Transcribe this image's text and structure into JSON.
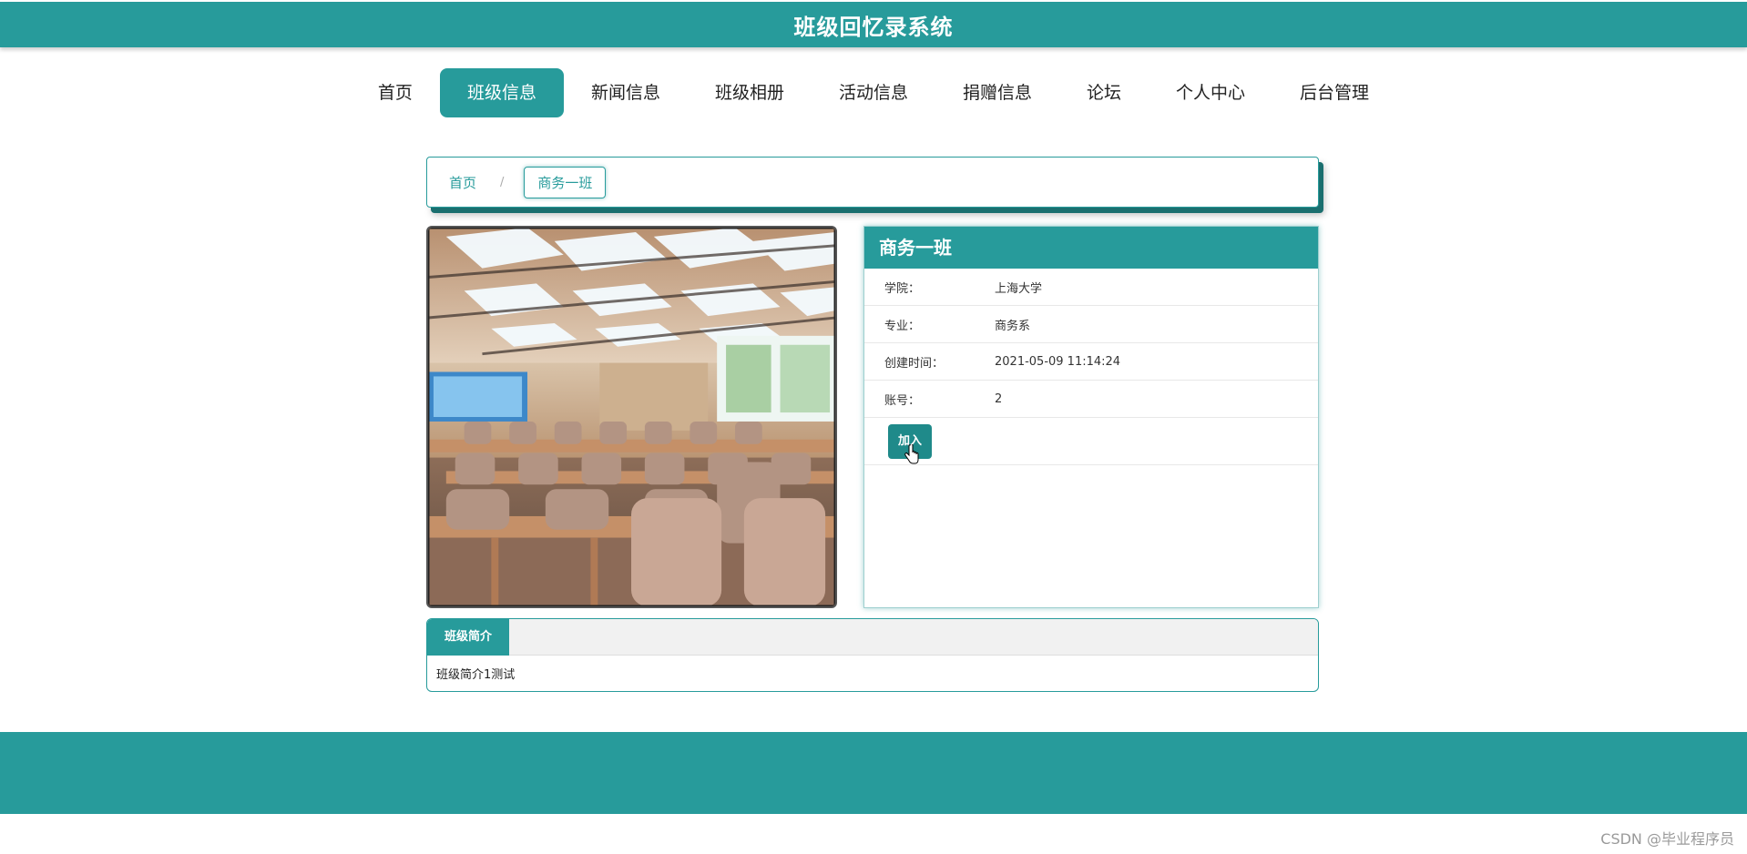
{
  "header": {
    "title": "班级回忆录系统"
  },
  "nav": {
    "items": [
      {
        "label": "首页",
        "active": false
      },
      {
        "label": "班级信息",
        "active": true
      },
      {
        "label": "新闻信息",
        "active": false
      },
      {
        "label": "班级相册",
        "active": false
      },
      {
        "label": "活动信息",
        "active": false
      },
      {
        "label": "捐赠信息",
        "active": false
      },
      {
        "label": "论坛",
        "active": false
      },
      {
        "label": "个人中心",
        "active": false
      },
      {
        "label": "后台管理",
        "active": false
      }
    ]
  },
  "breadcrumb": {
    "home": "首页",
    "separator": "/",
    "current": "商务一班"
  },
  "detail": {
    "title": "商务一班",
    "fields": [
      {
        "label": "学院：",
        "value": "上海大学"
      },
      {
        "label": "专业：",
        "value": "商务系"
      },
      {
        "label": "创建时间：",
        "value": "2021-05-09 11:14:24"
      },
      {
        "label": "账号：",
        "value": "2"
      }
    ],
    "join_label": "加入"
  },
  "intro": {
    "tab_label": "班级简介",
    "content": "班级简介1测试"
  },
  "watermark": "CSDN @毕业程序员",
  "colors": {
    "accent": "#279b9b",
    "button": "#1f8a8a"
  }
}
